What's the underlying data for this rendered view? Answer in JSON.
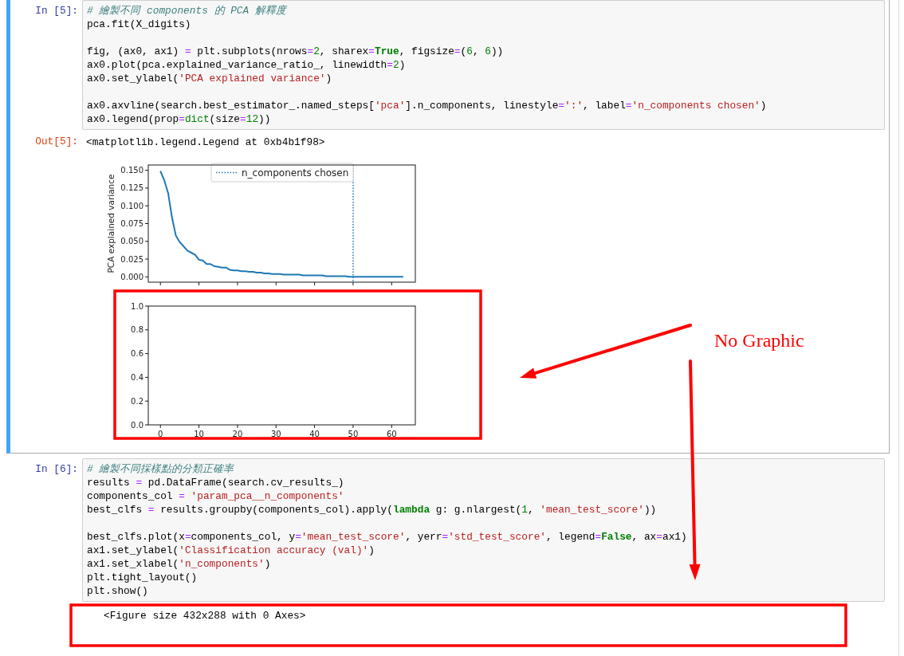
{
  "cells": [
    {
      "prompt": "In [5]:",
      "selected": true,
      "code": [
        {
          "kind": "code",
          "tokens": [
            {
              "kind": "comment",
              "text": "# 繪製不同 components 的 PCA 解釋度"
            }
          ]
        },
        {
          "kind": "code",
          "tokens": [
            {
              "kind": "plain",
              "text": "pca.fit(X_digits)"
            }
          ]
        },
        {
          "kind": "blank"
        },
        {
          "kind": "code",
          "tokens": [
            {
              "kind": "plain",
              "text": "fig, (ax0, ax1) "
            },
            {
              "kind": "op",
              "text": "="
            },
            {
              "kind": "plain",
              "text": " plt.subplots(nrows"
            },
            {
              "kind": "op",
              "text": "="
            },
            {
              "kind": "number",
              "text": "2"
            },
            {
              "kind": "plain",
              "text": ", sharex"
            },
            {
              "kind": "op",
              "text": "="
            },
            {
              "kind": "keyword",
              "text": "True"
            },
            {
              "kind": "plain",
              "text": ", figsize"
            },
            {
              "kind": "op",
              "text": "="
            },
            {
              "kind": "plain",
              "text": "("
            },
            {
              "kind": "number",
              "text": "6"
            },
            {
              "kind": "plain",
              "text": ", "
            },
            {
              "kind": "number",
              "text": "6"
            },
            {
              "kind": "plain",
              "text": "))"
            }
          ]
        },
        {
          "kind": "code",
          "tokens": [
            {
              "kind": "plain",
              "text": "ax0.plot(pca.explained_variance_ratio_, linewidth"
            },
            {
              "kind": "op",
              "text": "="
            },
            {
              "kind": "number",
              "text": "2"
            },
            {
              "kind": "plain",
              "text": ")"
            }
          ]
        },
        {
          "kind": "code",
          "tokens": [
            {
              "kind": "plain",
              "text": "ax0.set_ylabel("
            },
            {
              "kind": "string",
              "text": "'PCA explained variance'"
            },
            {
              "kind": "plain",
              "text": ")"
            }
          ]
        },
        {
          "kind": "blank"
        },
        {
          "kind": "code",
          "tokens": [
            {
              "kind": "plain",
              "text": "ax0.axvline(search.best_estimator_.named_steps["
            },
            {
              "kind": "string",
              "text": "'pca'"
            },
            {
              "kind": "plain",
              "text": "].n_components, linestyle"
            },
            {
              "kind": "op",
              "text": "="
            },
            {
              "kind": "string",
              "text": "':'"
            },
            {
              "kind": "plain",
              "text": ", label"
            },
            {
              "kind": "op",
              "text": "="
            },
            {
              "kind": "string",
              "text": "'n_components chosen'"
            },
            {
              "kind": "plain",
              "text": ")"
            }
          ]
        },
        {
          "kind": "code",
          "tokens": [
            {
              "kind": "plain",
              "text": "ax0.legend(prop"
            },
            {
              "kind": "op",
              "text": "="
            },
            {
              "kind": "builtin",
              "text": "dict"
            },
            {
              "kind": "plain",
              "text": "(size"
            },
            {
              "kind": "op",
              "text": "="
            },
            {
              "kind": "number",
              "text": "12"
            },
            {
              "kind": "plain",
              "text": "))"
            }
          ]
        }
      ],
      "output": {
        "prompt": "Out[5]:",
        "text": "<matplotlib.legend.Legend at 0xb4b1f98>",
        "charts": [
          {
            "chart_data": {
              "type": "line",
              "ylabel": "PCA explained variance",
              "x": [
                0,
                1,
                2,
                3,
                4,
                5,
                6,
                7,
                8,
                9,
                10,
                11,
                12,
                13,
                14,
                15,
                16,
                17,
                18,
                19,
                20,
                21,
                22,
                23,
                24,
                25,
                26,
                27,
                28,
                29,
                30,
                31,
                32,
                33,
                34,
                35,
                36,
                37,
                38,
                39,
                40,
                41,
                42,
                43,
                44,
                45,
                46,
                47,
                48,
                49,
                50,
                51,
                52,
                53,
                54,
                55,
                56,
                57,
                58,
                59,
                60,
                61,
                62,
                63
              ],
              "series": [
                {
                  "color": "#1f77b4",
                  "values": [
                    0.149,
                    0.136,
                    0.118,
                    0.084,
                    0.058,
                    0.049,
                    0.043,
                    0.037,
                    0.034,
                    0.031,
                    0.024,
                    0.023,
                    0.018,
                    0.018,
                    0.015,
                    0.014,
                    0.013,
                    0.013,
                    0.01,
                    0.009,
                    0.009,
                    0.008,
                    0.008,
                    0.007,
                    0.007,
                    0.006,
                    0.006,
                    0.005,
                    0.005,
                    0.004,
                    0.004,
                    0.004,
                    0.003,
                    0.003,
                    0.003,
                    0.003,
                    0.003,
                    0.002,
                    0.002,
                    0.002,
                    0.002,
                    0.002,
                    0.002,
                    0.001,
                    0.001,
                    0.001,
                    0.001,
                    0.001,
                    0.001,
                    0,
                    0,
                    0,
                    0,
                    0,
                    0,
                    0,
                    0,
                    0,
                    0,
                    0,
                    0,
                    0,
                    0,
                    0
                  ]
                }
              ],
              "xlim": [
                -3.15,
                66.15
              ],
              "ylim": [
                -0.0075,
                0.1575
              ],
              "yticks": [
                {
                  "value": 0,
                  "label": "0.000"
                },
                {
                  "value": 0.025,
                  "label": "0.025"
                },
                {
                  "value": 0.05,
                  "label": "0.050"
                },
                {
                  "value": 0.075,
                  "label": "0.075"
                },
                {
                  "value": 0.1,
                  "label": "0.100"
                },
                {
                  "value": 0.125,
                  "label": "0.125"
                },
                {
                  "value": 0.15,
                  "label": "0.150"
                }
              ],
              "ref_lines": [
                {
                  "axis": "x",
                  "value": 50,
                  "label": "n_components chosen"
                }
              ]
            }
          },
          {
            "chart_data": {
              "type": "line",
              "xlim": [
                -3.15,
                66.15
              ],
              "ylim": [
                0,
                1
              ],
              "xticks": [
                0,
                10,
                20,
                30,
                40,
                50,
                60
              ],
              "yticks": [
                {
                  "value": 0,
                  "label": "0.0"
                },
                {
                  "value": 0.2,
                  "label": "0.2"
                },
                {
                  "value": 0.4,
                  "label": "0.4"
                },
                {
                  "value": 0.6,
                  "label": "0.6"
                },
                {
                  "value": 0.8,
                  "label": "0.8"
                },
                {
                  "value": 1,
                  "label": "1.0"
                }
              ]
            }
          }
        ]
      }
    },
    {
      "prompt": "In [6]:",
      "selected": false,
      "code": [
        {
          "kind": "code",
          "tokens": [
            {
              "kind": "comment",
              "text": "# 繪製不同採樣點的分類正確率"
            }
          ]
        },
        {
          "kind": "code",
          "tokens": [
            {
              "kind": "plain",
              "text": "results "
            },
            {
              "kind": "op",
              "text": "="
            },
            {
              "kind": "plain",
              "text": " pd.DataFrame(search.cv_results_)"
            }
          ]
        },
        {
          "kind": "code",
          "tokens": [
            {
              "kind": "plain",
              "text": "components_col "
            },
            {
              "kind": "op",
              "text": "= "
            },
            {
              "kind": "string",
              "text": "'param_pca__n_components'"
            }
          ]
        },
        {
          "kind": "code",
          "tokens": [
            {
              "kind": "plain",
              "text": "best_clfs "
            },
            {
              "kind": "op",
              "text": "="
            },
            {
              "kind": "plain",
              "text": " results.groupby(components_col).apply("
            },
            {
              "kind": "keyword",
              "text": "lambda"
            },
            {
              "kind": "plain",
              "text": " g: g.nlargest("
            },
            {
              "kind": "number",
              "text": "1"
            },
            {
              "kind": "plain",
              "text": ", "
            },
            {
              "kind": "string",
              "text": "'mean_test_score'"
            },
            {
              "kind": "plain",
              "text": "))"
            }
          ]
        },
        {
          "kind": "blank"
        },
        {
          "kind": "code",
          "tokens": [
            {
              "kind": "plain",
              "text": "best_clfs.plot(x"
            },
            {
              "kind": "op",
              "text": "="
            },
            {
              "kind": "plain",
              "text": "components_col, y"
            },
            {
              "kind": "op",
              "text": "="
            },
            {
              "kind": "string",
              "text": "'mean_test_score'"
            },
            {
              "kind": "plain",
              "text": ", yerr"
            },
            {
              "kind": "op",
              "text": "="
            },
            {
              "kind": "string",
              "text": "'std_test_score'"
            },
            {
              "kind": "plain",
              "text": ", legend"
            },
            {
              "kind": "op",
              "text": "="
            },
            {
              "kind": "keyword",
              "text": "False"
            },
            {
              "kind": "plain",
              "text": ", ax"
            },
            {
              "kind": "op",
              "text": "="
            },
            {
              "kind": "plain",
              "text": "ax1)"
            }
          ]
        },
        {
          "kind": "code",
          "tokens": [
            {
              "kind": "plain",
              "text": "ax1.set_ylabel("
            },
            {
              "kind": "string",
              "text": "'Classification accuracy (val)'"
            },
            {
              "kind": "plain",
              "text": ")"
            }
          ]
        },
        {
          "kind": "code",
          "tokens": [
            {
              "kind": "plain",
              "text": "ax1.set_xlabel("
            },
            {
              "kind": "string",
              "text": "'n_components'"
            },
            {
              "kind": "plain",
              "text": ")"
            }
          ]
        },
        {
          "kind": "code",
          "tokens": [
            {
              "kind": "plain",
              "text": "plt.tight_layout()"
            }
          ]
        },
        {
          "kind": "code",
          "tokens": [
            {
              "kind": "plain",
              "text": "plt.show()"
            }
          ]
        }
      ],
      "output": {
        "text": "<Figure size 432x288 with 0 Axes>"
      }
    }
  ],
  "annotation": {
    "label": "No Graphic"
  }
}
